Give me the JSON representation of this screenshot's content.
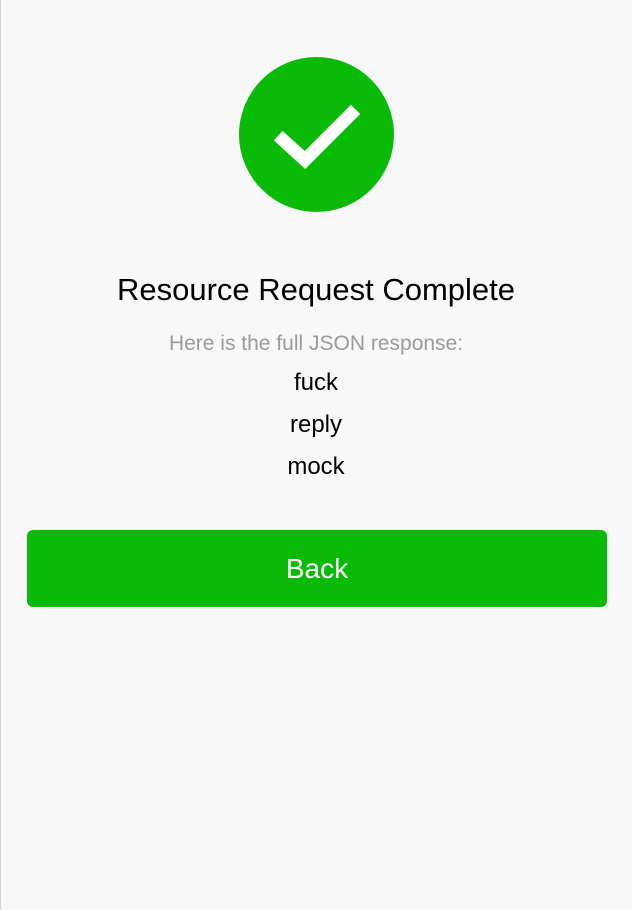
{
  "colors": {
    "accent": "#09bb07",
    "background": "#f8f8f8",
    "subtitle": "#9a9a9a"
  },
  "status_icon": "checkmark-success-icon",
  "title": "Resource Request Complete",
  "subtitle": "Here is the full JSON response:",
  "response_items": [
    "fuck",
    "reply",
    "mock"
  ],
  "back_button_label": "Back"
}
